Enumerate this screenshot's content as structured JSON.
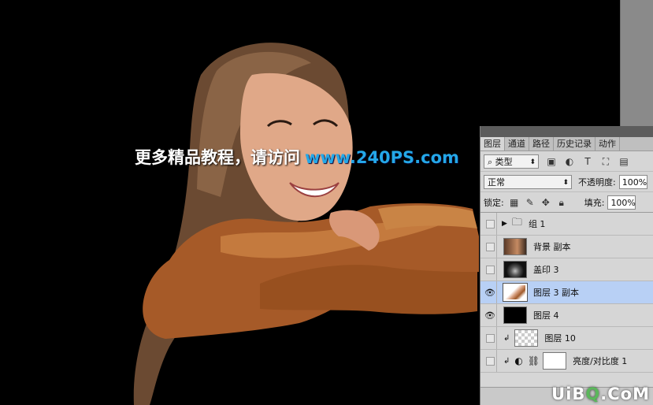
{
  "watermark": {
    "cn": "更多精品教程，请访问",
    "url": "www.240PS.com"
  },
  "panel": {
    "tabs": [
      "图层",
      "通道",
      "路径",
      "历史记录",
      "动作"
    ],
    "kind_label": "类型",
    "blend_mode": "正常",
    "opacity_label": "不透明度:",
    "opacity_value": "100%",
    "lock_label": "锁定:",
    "fill_label": "填充:",
    "fill_value": "100%",
    "layers": [
      {
        "name": "组 1"
      },
      {
        "name": "背景 副本"
      },
      {
        "name": "盖印 3"
      },
      {
        "name": "图层 3 副本"
      },
      {
        "name": "图层 4"
      },
      {
        "name": "图层 10"
      },
      {
        "name": "亮度/对比度 1"
      }
    ]
  },
  "site_mark": {
    "text_a": "UiB",
    "text_o": "Q",
    "text_b": ".CoM"
  },
  "colors": {
    "watermark_url": "#24a8e8",
    "selected_layer": "#b8d0f5"
  }
}
